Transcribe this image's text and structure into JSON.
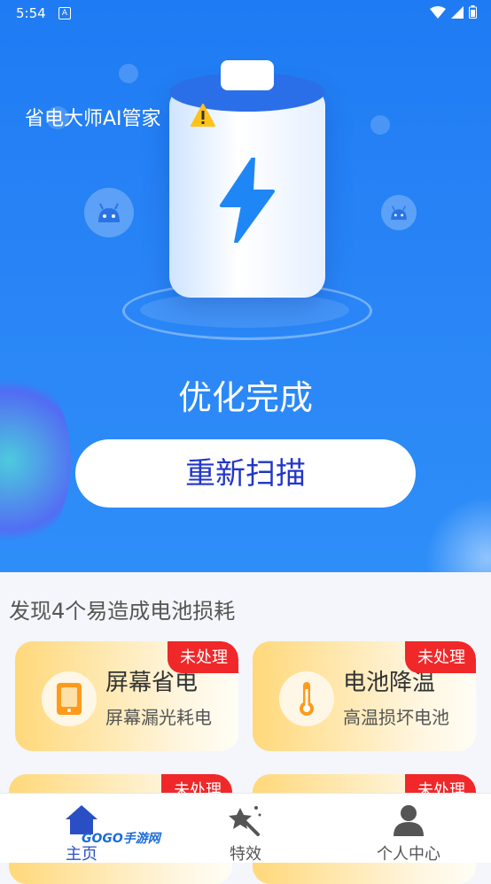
{
  "status_bar": {
    "time": "5:54",
    "notification_icon": "A"
  },
  "app": {
    "title": "省电大师AI管家"
  },
  "hero": {
    "status_text": "优化完成",
    "rescan_label": "重新扫描"
  },
  "issues": {
    "title": "发现4个易造成电池损耗",
    "cards": [
      {
        "title": "屏幕省电",
        "subtitle": "屏幕漏光耗电",
        "badge": "未处理",
        "icon": "tablet-icon"
      },
      {
        "title": "电池降温",
        "subtitle": "高温损坏电池",
        "badge": "未处理",
        "icon": "thermometer-icon"
      },
      {
        "title": "",
        "subtitle": "",
        "badge": "未处理",
        "icon": ""
      },
      {
        "title": "",
        "subtitle": "",
        "badge": "未处理",
        "icon": ""
      }
    ]
  },
  "nav": {
    "items": [
      {
        "label": "主页",
        "icon": "home-icon",
        "active": true
      },
      {
        "label": "特效",
        "icon": "magic-wand-icon",
        "active": false
      },
      {
        "label": "个人中心",
        "icon": "person-icon",
        "active": false
      }
    ]
  },
  "watermark": "GOGO手游网",
  "colors": {
    "primary": "#1f7bf3",
    "badge": "#f0282a",
    "rescan_text": "#2236c8",
    "nav_active": "#2a4fc4"
  }
}
